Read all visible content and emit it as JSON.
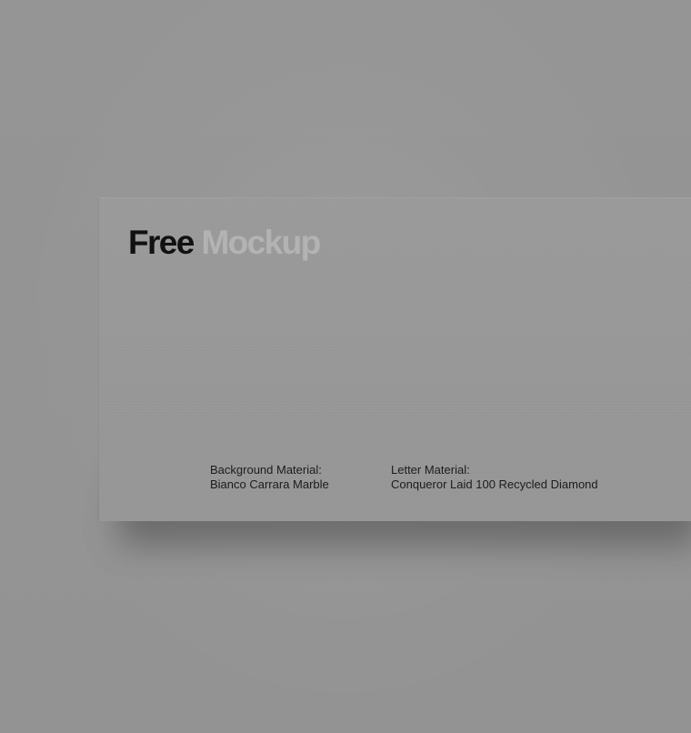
{
  "mockup": {
    "title_primary": "Free",
    "title_secondary": "Mockup",
    "background_material": {
      "label": "Background Material:",
      "value": "Bianco Carrara Marble"
    },
    "letter_material": {
      "label": "Letter Material:",
      "value": "Conqueror Laid 100 Recycled Diamond"
    }
  },
  "colors": {
    "background": "#949494",
    "card": "#989898",
    "title_primary": "#111111",
    "title_secondary": "#b3b3b3",
    "body_text": "#1c1c1c"
  }
}
